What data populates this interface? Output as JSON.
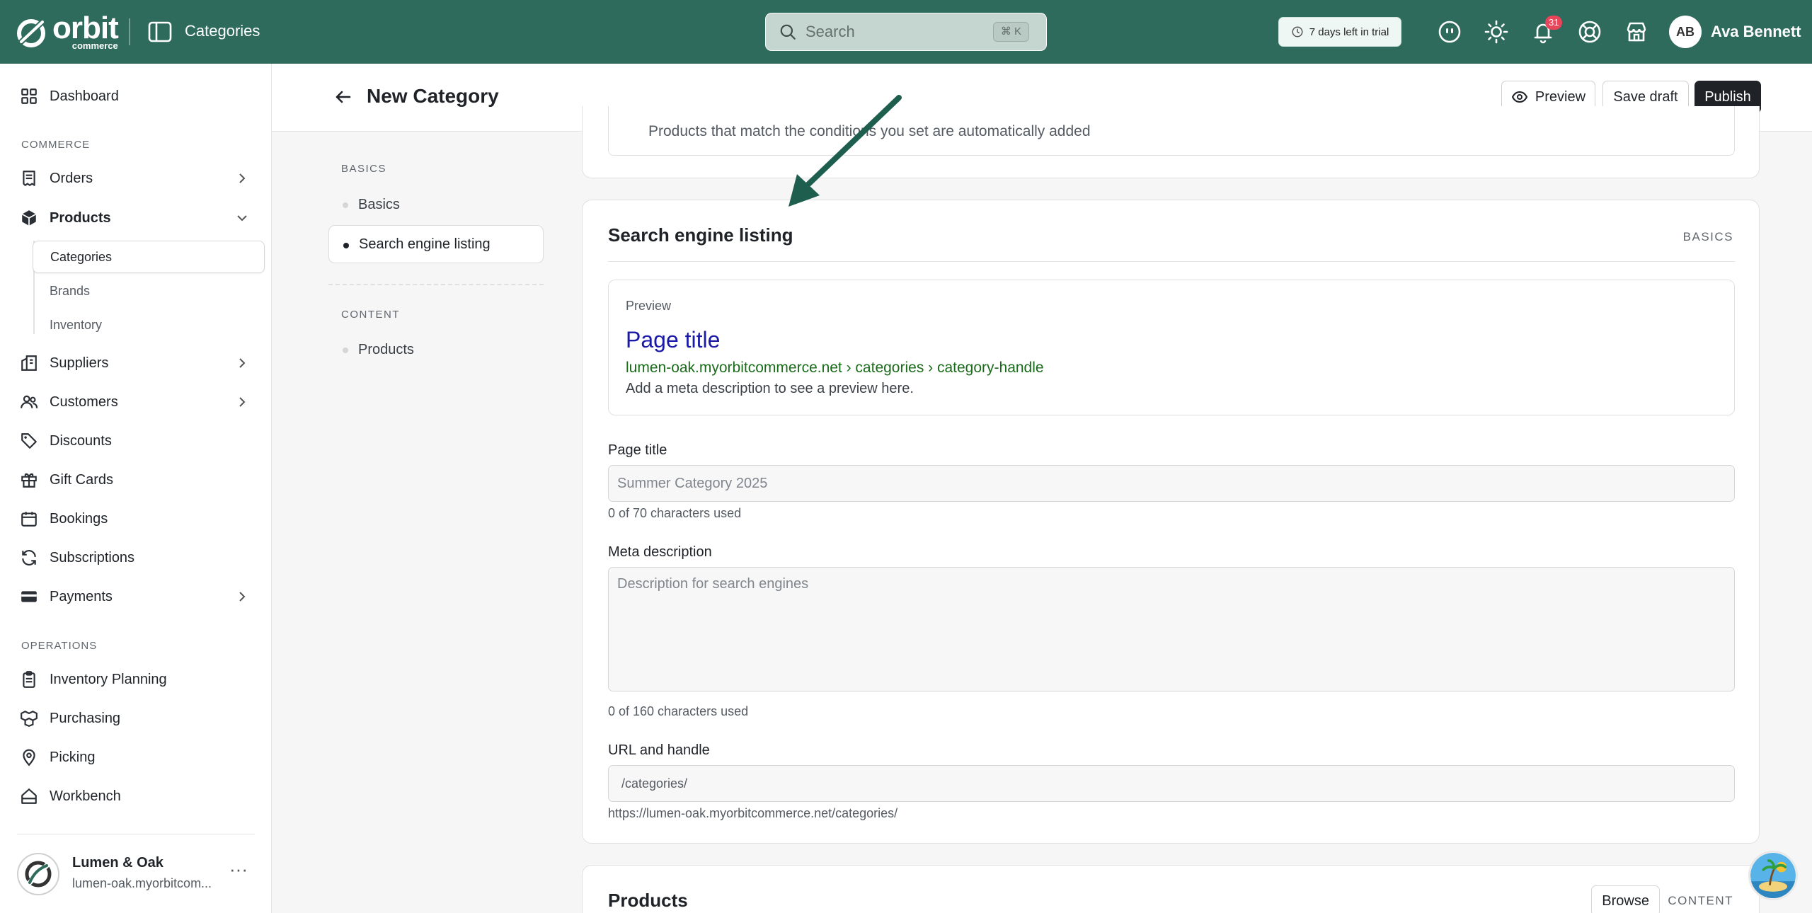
{
  "brand": {
    "name": "orbit",
    "sub": "commerce"
  },
  "topbar": {
    "section": "Categories",
    "search_placeholder": "Search",
    "search_shortcut": "⌘ K",
    "trial": "7 days left in trial",
    "notifications_count": "31",
    "user": {
      "initials": "AB",
      "name": "Ava Bennett"
    }
  },
  "sidebar": {
    "dashboard": "Dashboard",
    "commerce_label": "COMMERCE",
    "orders": "Orders",
    "products": "Products",
    "products_sub": [
      "Categories",
      "Brands",
      "Inventory"
    ],
    "suppliers": "Suppliers",
    "customers": "Customers",
    "discounts": "Discounts",
    "gift_cards": "Gift Cards",
    "bookings": "Bookings",
    "subscriptions": "Subscriptions",
    "payments": "Payments",
    "operations_label": "OPERATIONS",
    "inventory_planning": "Inventory Planning",
    "purchasing": "Purchasing",
    "picking": "Picking",
    "workbench": "Workbench",
    "store": {
      "name": "Lumen & Oak",
      "url": "lumen-oak.myorbitcom..."
    }
  },
  "header": {
    "title": "New Category",
    "preview": "Preview",
    "save_draft": "Save draft",
    "publish": "Publish"
  },
  "section_nav": {
    "basics_label": "BASICS",
    "basics": "Basics",
    "seo": "Search engine listing",
    "content_label": "CONTENT",
    "products": "Products"
  },
  "top_card": {
    "text": "Products that match the conditions you set are automatically added"
  },
  "seo_card": {
    "title": "Search engine listing",
    "tag": "BASICS",
    "preview_label": "Preview",
    "preview_title": "Page title",
    "preview_url": "lumen-oak.myorbitcommerce.net › categories › category-handle",
    "preview_desc": "Add a meta description to see a preview here.",
    "page_title_label": "Page title",
    "page_title_placeholder": "Summer Category 2025",
    "page_title_help": "0 of 70 characters used",
    "meta_label": "Meta description",
    "meta_placeholder": "Description for search engines",
    "meta_help": "0 of 160 characters used",
    "url_label": "URL and handle",
    "url_placeholder": "/categories/",
    "url_help": "https://lumen-oak.myorbitcommerce.net/categories/"
  },
  "products_card": {
    "title": "Products",
    "browse": "Browse",
    "tag": "CONTENT"
  },
  "colors": {
    "topbar": "#2f6b5c",
    "primary_button": "#1f2328",
    "arrow": "#1e5e4e",
    "badge": "#e8445a"
  }
}
